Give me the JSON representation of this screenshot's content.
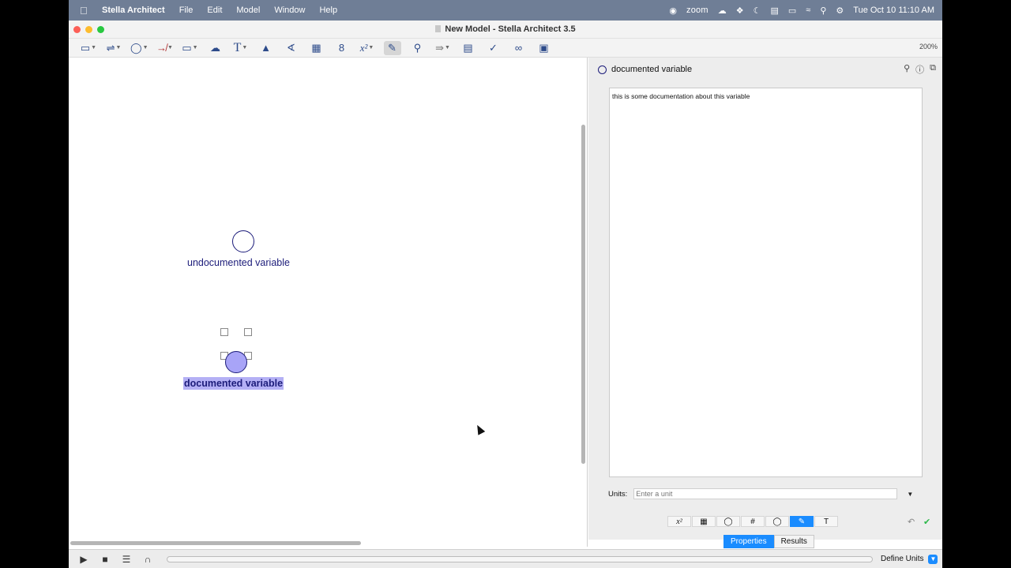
{
  "menubar": {
    "app_name": "Stella Architect",
    "menus": [
      "File",
      "Edit",
      "Model",
      "Window",
      "Help"
    ],
    "zoom_label": "zoom",
    "datetime": "Tue Oct 10  11:10 AM"
  },
  "window": {
    "title": "New Model - Stella Architect 3.5",
    "zoom_level": "200%"
  },
  "canvas": {
    "variables": [
      {
        "label": "undocumented variable",
        "selected": false
      },
      {
        "label": "documented variable",
        "selected": true
      }
    ]
  },
  "panel": {
    "variable_name": "documented variable",
    "documentation": "this is some documentation about this variable",
    "units_label": "Units:",
    "units_placeholder": "Enter a unit",
    "tabs": [
      "Properties",
      "Results"
    ],
    "active_tab": "Properties"
  },
  "bottombar": {
    "define_units_label": "Define Units",
    "run_progress": 0
  },
  "colors": {
    "accent": "#1a8cff",
    "variable_stroke": "#1c1c7a",
    "selected_fill": "#a8a4f7"
  }
}
